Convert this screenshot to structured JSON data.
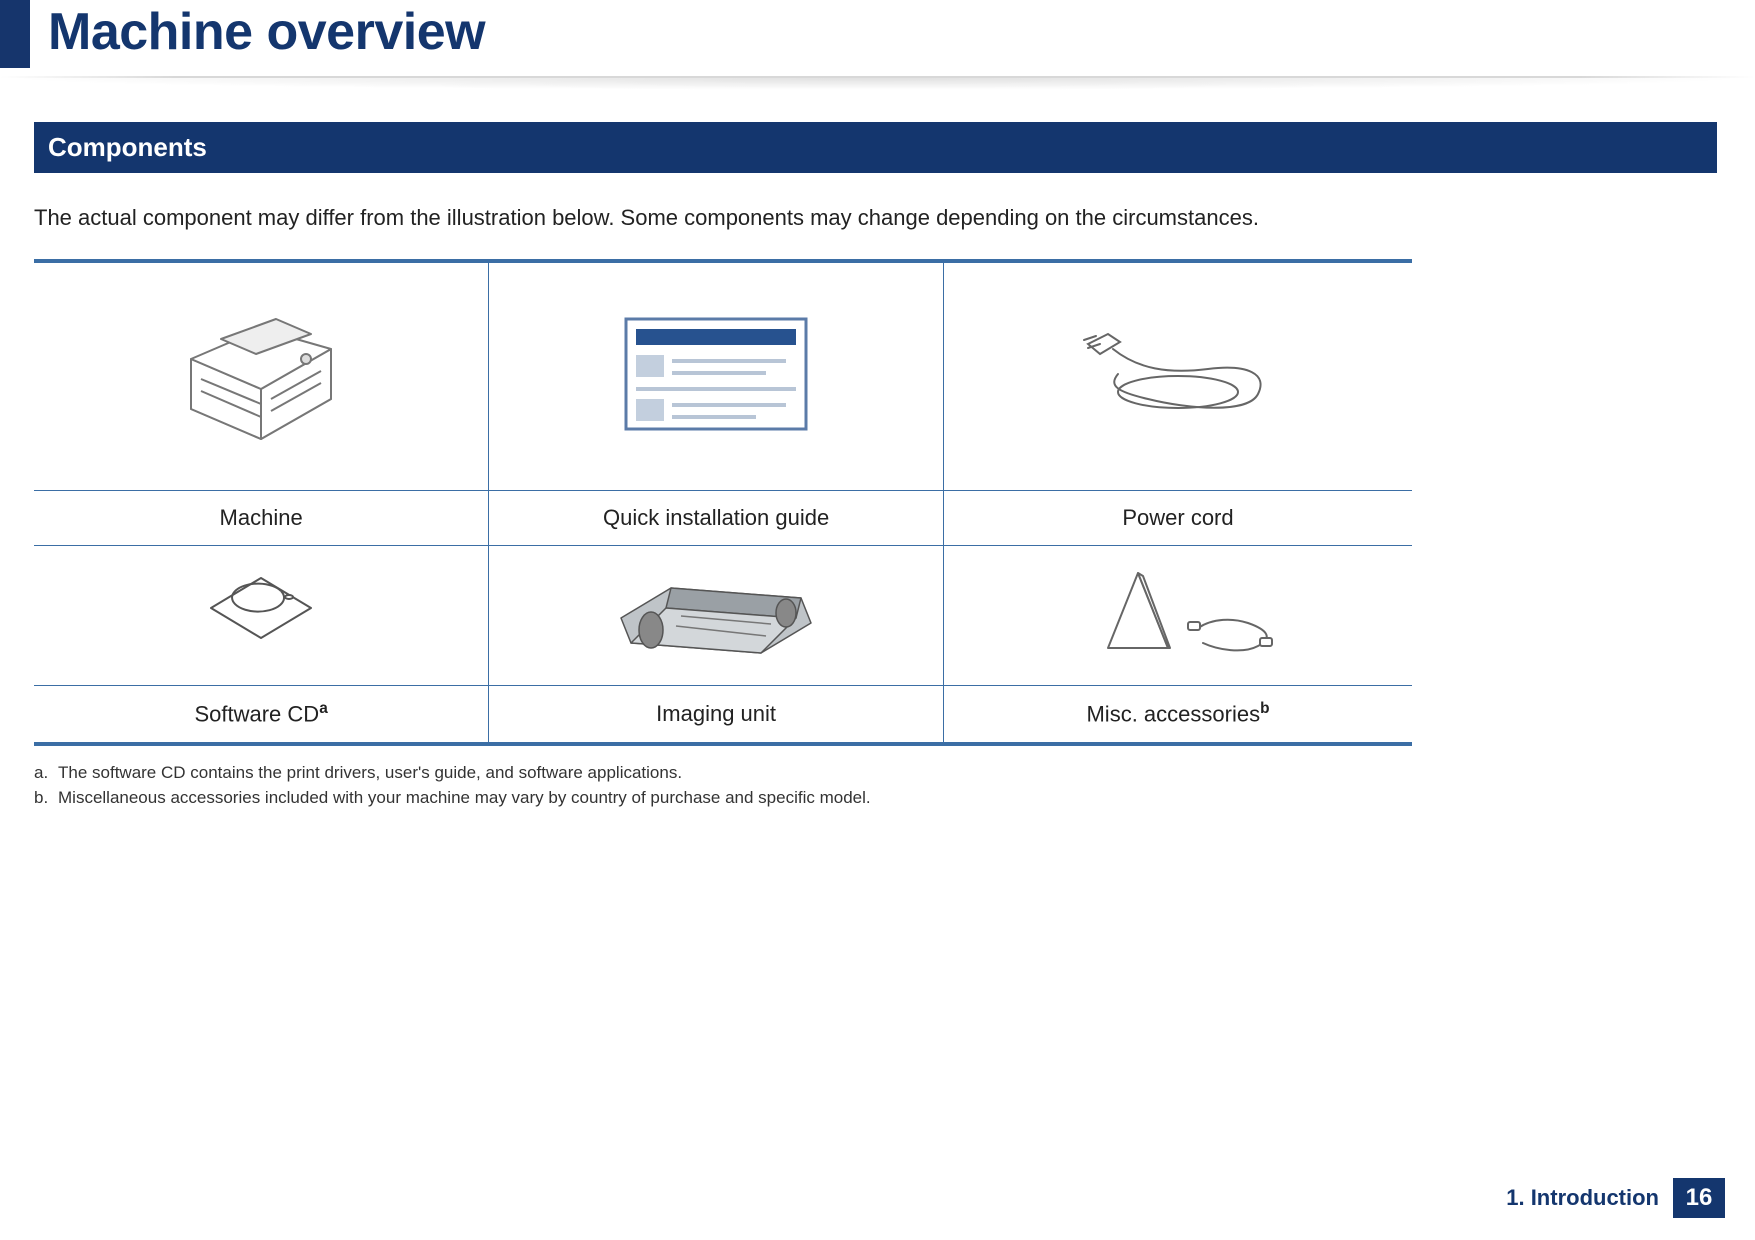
{
  "page_title": "Machine overview",
  "section_title": "Components",
  "intro_text": "The actual component may differ from the illustration below. Some components may change depending on the circumstances.",
  "components": {
    "row1": [
      {
        "label": "Machine",
        "icon": "printer-icon"
      },
      {
        "label": "Quick installation guide",
        "icon": "guide-icon"
      },
      {
        "label": "Power cord",
        "icon": "powercord-icon"
      }
    ],
    "row2": [
      {
        "label": "Software CD",
        "sup": "a",
        "icon": "cd-icon"
      },
      {
        "label": "Imaging unit",
        "icon": "imagingunit-icon"
      },
      {
        "label": "Misc. accessories",
        "sup": "b",
        "icon": "misc-icon"
      }
    ]
  },
  "footnotes": [
    {
      "mark": "a.",
      "text": "The software CD contains the print drivers, user's guide, and software applications."
    },
    {
      "mark": "b.",
      "text": "Miscellaneous accessories included with your machine may vary by country of purchase and specific model."
    }
  ],
  "footer": {
    "chapter": "1. Introduction",
    "page_number": "16"
  }
}
